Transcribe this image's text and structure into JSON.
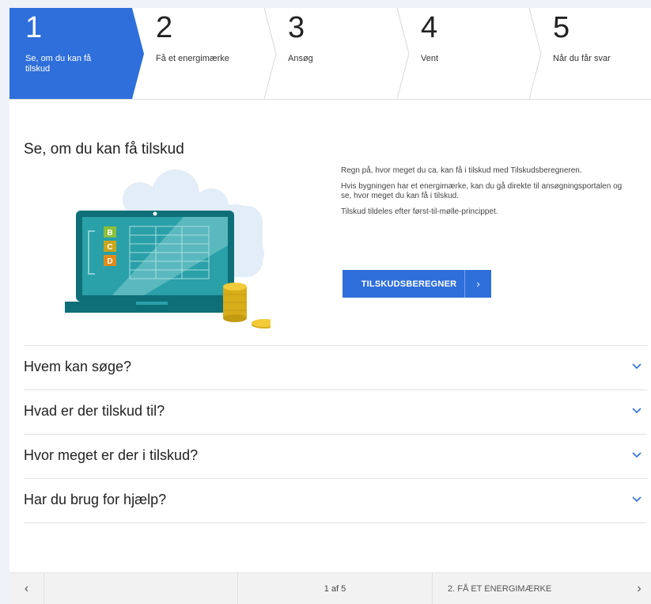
{
  "stepper": {
    "steps": [
      {
        "number": "1",
        "label": "Se, om du kan få tilskud"
      },
      {
        "number": "2",
        "label": "Få et energimærke"
      },
      {
        "number": "3",
        "label": "Ansøg"
      },
      {
        "number": "4",
        "label": "Vent"
      },
      {
        "number": "5",
        "label": "Når du får svar"
      }
    ],
    "active_color": "#2f6fdb"
  },
  "intro": {
    "title": "Se, om du kan få tilskud",
    "paragraphs": [
      "Regn på, hvor meget du ca. kan få i tilskud med Tilskudsberegneren.",
      "Hvis bygningen har et energimærke, kan du gå direkte til ansøgningsportalen og se, hvor meget du kan få i tilskud.",
      "Tilskud tildeles efter først-til-mølle-princippet."
    ],
    "cta_label": "TILSKUDSBEREGNER",
    "illustration_letters": [
      "B",
      "C",
      "D"
    ]
  },
  "accordion": [
    {
      "title": "Hvem kan søge?"
    },
    {
      "title": "Hvad er der tilskud til?"
    },
    {
      "title": "Hvor meget er der i tilskud?"
    },
    {
      "title": "Har du brug for hjælp?"
    }
  ],
  "pager": {
    "page_indicator": "1 af 5",
    "next_label": "2. FÅ ET ENERGIMÆRKE"
  }
}
